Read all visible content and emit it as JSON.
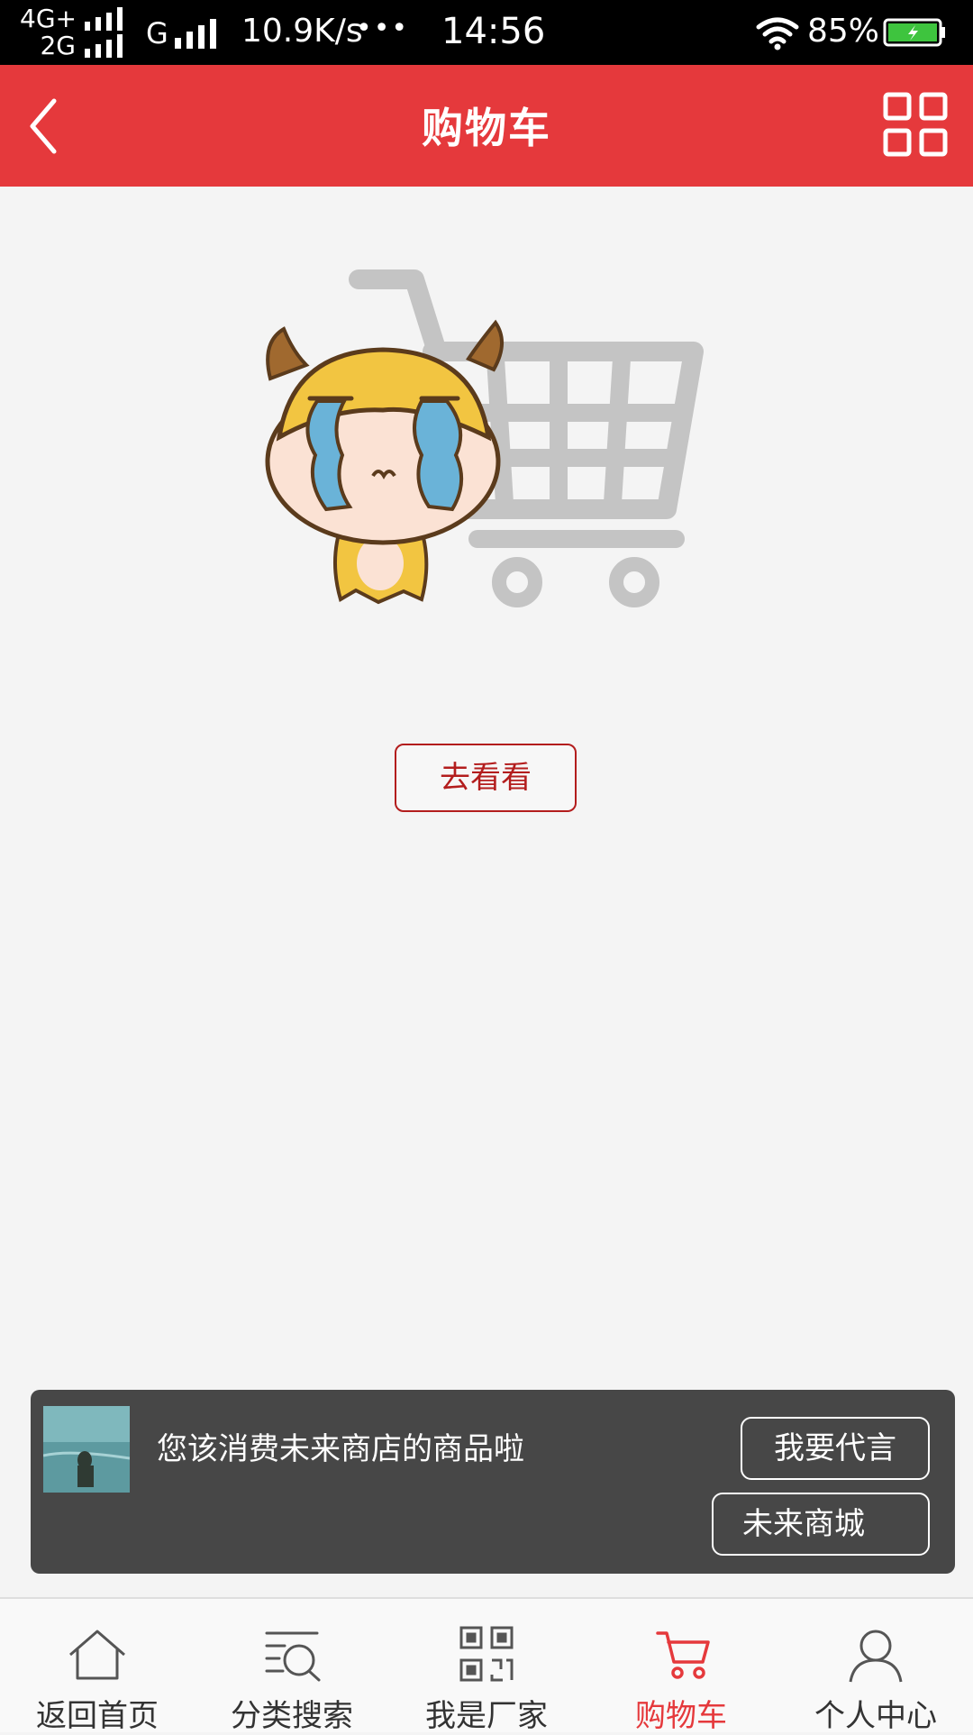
{
  "status_bar": {
    "network_top": "4G+",
    "network_bottom": "2G",
    "network_g": "G",
    "speed": "10.9K/s",
    "dots": "•••",
    "time": "14:56",
    "battery_percent": "85%"
  },
  "header": {
    "title": "购物车",
    "back_icon": "chevron-left-icon",
    "menu_icon": "grid-icon",
    "background_color": "#e5393c"
  },
  "empty_state": {
    "illustration": "crying-calf-with-shopping-cart",
    "button_label": "去看看",
    "button_color": "#b31d1d"
  },
  "toast": {
    "message": "您该消费未来商店的商品啦",
    "primary_button": "我要代言",
    "secondary_button": "未来商城"
  },
  "bottom_nav": {
    "active_color": "#e5393c",
    "items": [
      {
        "label": "返回首页",
        "icon": "home-icon"
      },
      {
        "label": "分类搜索",
        "icon": "search-category-icon"
      },
      {
        "label": "我是厂家",
        "icon": "qr-code-icon"
      },
      {
        "label": "购物车",
        "icon": "cart-icon",
        "active": true
      },
      {
        "label": "个人中心",
        "icon": "person-icon"
      }
    ]
  }
}
